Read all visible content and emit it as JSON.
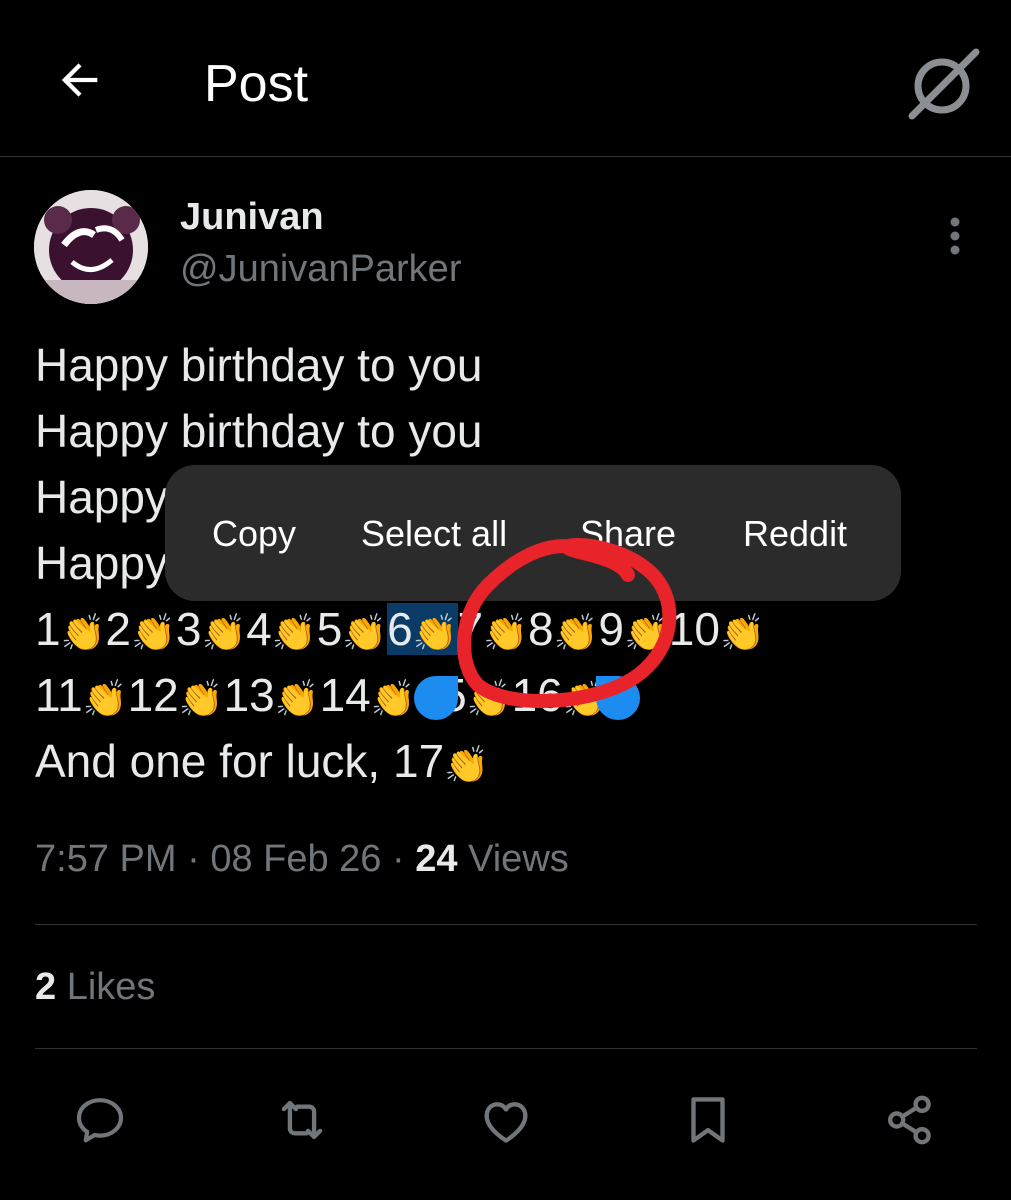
{
  "header": {
    "title": "Post"
  },
  "post": {
    "author_name": "Junivan",
    "author_handle": "@JunivanParker",
    "lines": [
      "Happy birthday to you",
      "Happy birthday to you",
      "Happy",
      "Happy"
    ],
    "count_line1": [
      "1",
      "2",
      "3",
      "4",
      "5",
      "6",
      "7",
      "8",
      "9",
      "10"
    ],
    "count_line2": [
      "11",
      "12",
      "13",
      "14",
      "15",
      "16"
    ],
    "final_line": "And one for luck, 17",
    "clap_emoji": "👏",
    "time": "7:57 PM",
    "date": "08 Feb 26",
    "views_count": "24",
    "views_label": "Views",
    "likes_count": "2",
    "likes_label": "Likes",
    "separator": "·"
  },
  "context_menu": {
    "copy": "Copy",
    "select_all": "Select all",
    "share": "Share",
    "reddit": "Reddit"
  },
  "colors": {
    "selection": "#0a3a66",
    "selection_handle": "#1d8cf0",
    "annotation": "#e8232a"
  },
  "icons": [
    "back-arrow-icon",
    "grok-icon",
    "more-vertical-icon",
    "reply-icon",
    "repost-icon",
    "like-icon",
    "bookmark-icon",
    "share-icon"
  ]
}
